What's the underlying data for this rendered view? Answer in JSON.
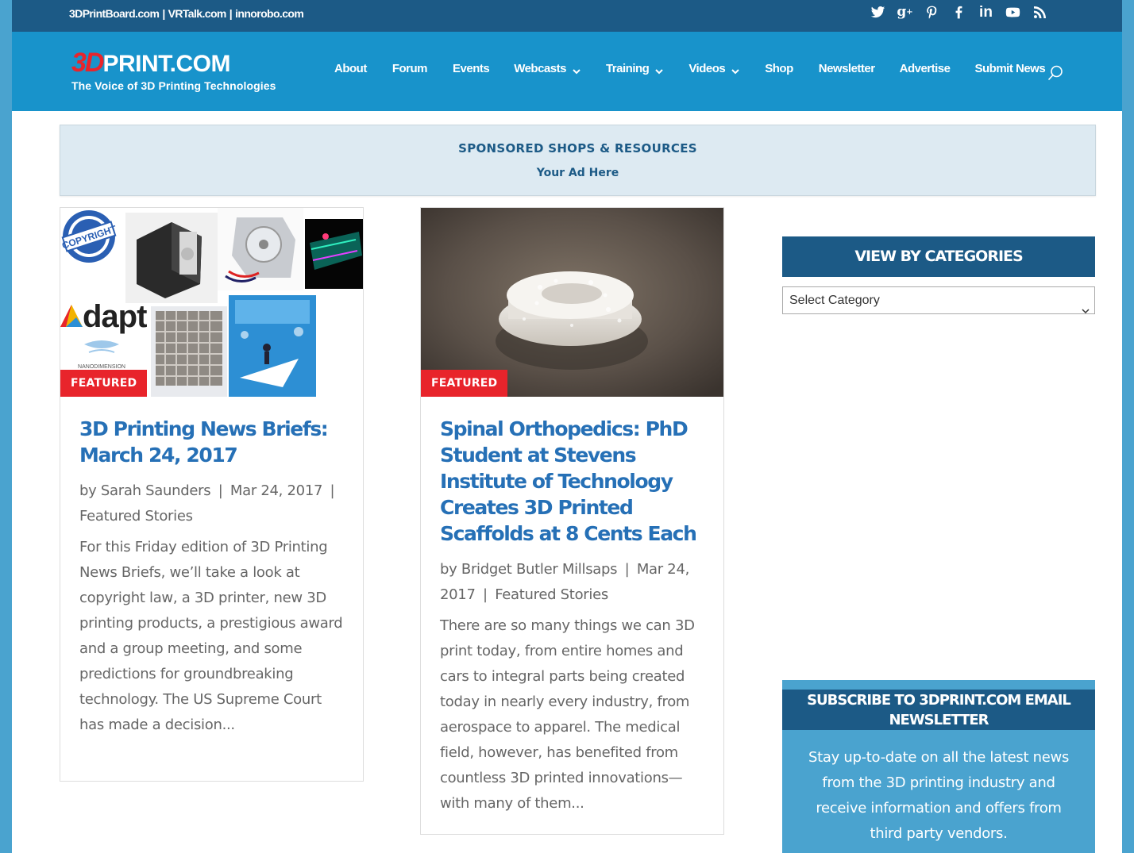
{
  "topbar": {
    "links": [
      "3DPrintBoard.com",
      "VRTalk.com",
      "innorobo.com"
    ],
    "separator": "|",
    "social_icons": [
      "twitter-icon",
      "google-plus-icon",
      "pinterest-icon",
      "facebook-icon",
      "linkedin-icon",
      "youtube-icon",
      "rss-icon"
    ]
  },
  "header": {
    "logo_3d": "3D",
    "logo_rest": "PRINT.COM",
    "tagline": "The Voice of 3D Printing Technologies",
    "nav": [
      {
        "label": "About",
        "dropdown": false
      },
      {
        "label": "Forum",
        "dropdown": false
      },
      {
        "label": "Events",
        "dropdown": false
      },
      {
        "label": "Webcasts",
        "dropdown": true
      },
      {
        "label": "Training",
        "dropdown": true
      },
      {
        "label": "Videos",
        "dropdown": true
      },
      {
        "label": "Shop",
        "dropdown": false
      },
      {
        "label": "Newsletter",
        "dropdown": false
      },
      {
        "label": "Advertise",
        "dropdown": false
      },
      {
        "label": "Submit News",
        "dropdown": false
      }
    ]
  },
  "sponsor": {
    "title": "SPONSORED SHOPS & RESOURCES",
    "subtitle": "Your Ad Here"
  },
  "posts": [
    {
      "badge": "FEATURED",
      "title": "3D Printing News Briefs: March 24, 2017",
      "by": "by",
      "author": "Sarah Saunders",
      "date": "Mar 24, 2017",
      "category": "Featured Stories",
      "excerpt": "For this Friday edition of 3D Printing News Briefs, we’ll take a look at copyright law, a 3D printer, new 3D printing products, a prestigious award and a group meeting, and some predictions for groundbreaking technology. The US Supreme Court has made a decision...",
      "image_text": {
        "copyright": "COPYRIGHT",
        "adapt": "dapt",
        "nano": "NANODIMENSION"
      }
    },
    {
      "badge": "FEATURED",
      "title": "Spinal Orthopedics: PhD Student at Stevens Institute of Technology Creates 3D Printed Scaffolds at 8 Cents Each",
      "by": "by",
      "author": "Bridget Butler Millsaps",
      "date": "Mar 24, 2017",
      "category": "Featured Stories",
      "excerpt": "There are so many things we can 3D print today, from entire homes and cars to integral parts being created today in nearly every industry, from aerospace to apparel. The medical field, however, has benefited from countless 3D printed innovations—with many of them..."
    }
  ],
  "sidebar": {
    "categories_title": "VIEW BY CATEGORIES",
    "select_value": "Select Category",
    "subscribe_title": "SUBSCRIBE TO 3DPRINT.COM EMAIL NEWSLETTER",
    "subscribe_text": "Stay up-to-date on all the latest news from the 3D printing industry and receive information and offers from third party vendors."
  },
  "colors": {
    "dark_blue": "#1c5a86",
    "header_blue": "#1893cb",
    "link_blue": "#2670b6",
    "accent_red": "#e8242b",
    "light_blue": "#4aa3cf"
  }
}
